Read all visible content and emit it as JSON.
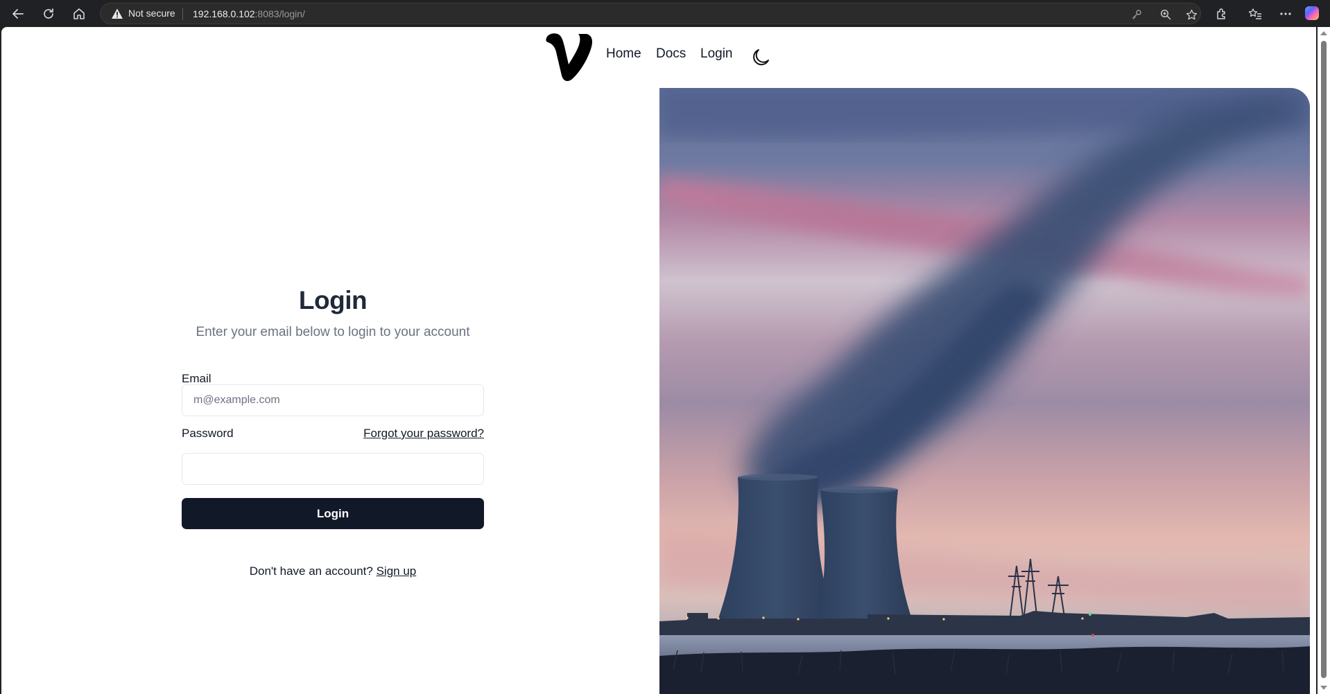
{
  "browser": {
    "security_label": "Not secure",
    "url_host": "192.168.0.102",
    "url_rest": ":8083/login/",
    "icons": [
      "back-icon",
      "reload-icon",
      "home-icon",
      "warning-icon",
      "key-icon",
      "zoom-icon",
      "favorite-star-icon",
      "extensions-icon",
      "favorites-list-icon",
      "more-icon",
      "copilot-icon"
    ]
  },
  "header": {
    "logo_icon": "v-logo",
    "nav": {
      "home": "Home",
      "docs": "Docs",
      "login": "Login"
    },
    "theme_icon": "moon-icon"
  },
  "login": {
    "title": "Login",
    "subtitle": "Enter your email below to login to your account",
    "email_label": "Email",
    "email_placeholder": "m@example.com",
    "email_value": "",
    "password_label": "Password",
    "password_value": "",
    "forgot_link": "Forgot your password?",
    "submit_label": "Login",
    "signup_prompt": "Don't have an account?",
    "signup_link": "Sign up"
  },
  "colors": {
    "primary_button": "#111827",
    "muted_text": "#6b7280",
    "border": "#e5e7eb"
  },
  "hero": {
    "image_subject": "cooling-towers-at-dusk"
  }
}
